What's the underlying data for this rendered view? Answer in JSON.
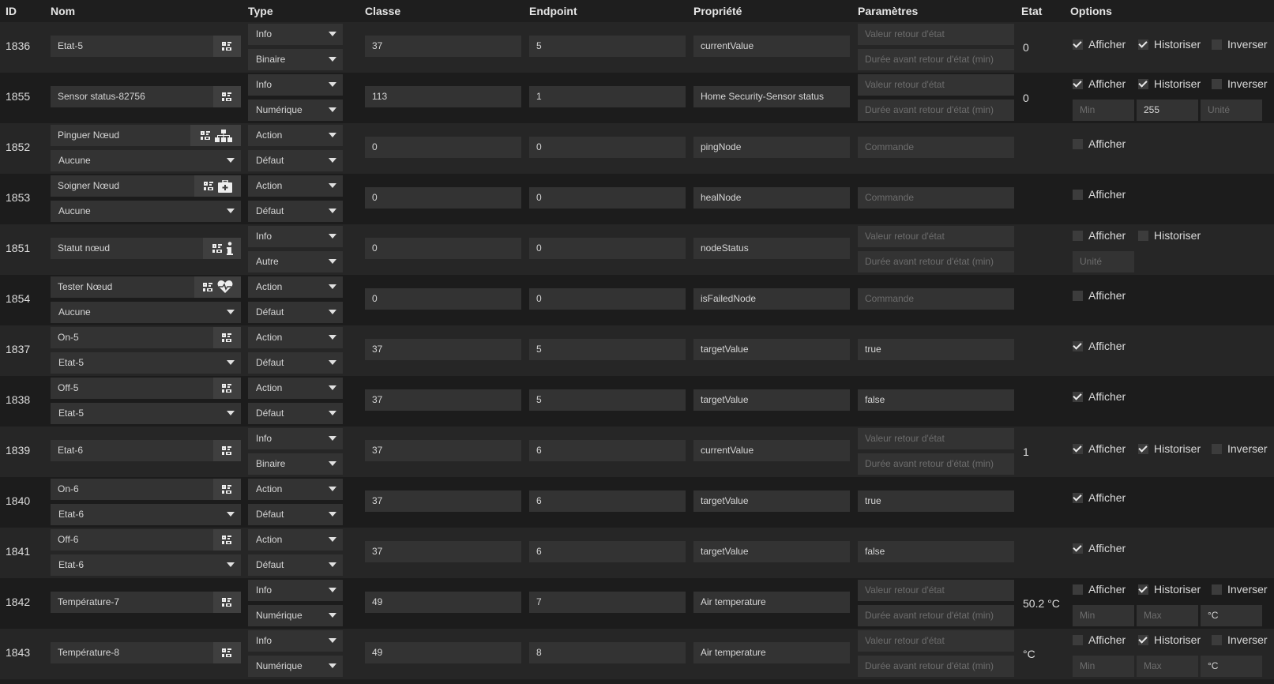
{
  "headers": {
    "id": "ID",
    "nom": "Nom",
    "type": "Type",
    "classe": "Classe",
    "endpoint": "Endpoint",
    "propriete": "Propriété",
    "parametres": "Paramètres",
    "etat": "Etat",
    "options": "Options"
  },
  "labels": {
    "afficher": "Afficher",
    "historiser": "Historiser",
    "inverser": "Inverser"
  },
  "placeholders": {
    "valeur_retour": "Valeur retour d'état",
    "duree_retour": "Durée avant retour d'état (min)",
    "commande": "Commande",
    "min": "Min",
    "max": "Max",
    "unite": "Unité"
  },
  "rows": [
    {
      "id": "1836",
      "name": "Etat-5",
      "type": "Info",
      "subtype": "Binaire",
      "classe": "37",
      "endpoint": "5",
      "propriete": "currentValue",
      "etat": "0",
      "afficher": true,
      "historiser": true,
      "inverser": false
    },
    {
      "id": "1855",
      "name": "Sensor status-82756",
      "type": "Info",
      "subtype": "Numérique",
      "classe": "113",
      "endpoint": "1",
      "propriete": "Home Security-Sensor status",
      "etat": "0",
      "afficher": true,
      "historiser": true,
      "inverser": false,
      "max": "255"
    },
    {
      "id": "1852",
      "name": "Pinguer Nœud",
      "action": "Aucune",
      "type": "Action",
      "subtype": "Défaut",
      "classe": "0",
      "endpoint": "0",
      "propriete": "pingNode",
      "afficher": false
    },
    {
      "id": "1853",
      "name": "Soigner Nœud",
      "action": "Aucune",
      "type": "Action",
      "subtype": "Défaut",
      "classe": "0",
      "endpoint": "0",
      "propriete": "healNode",
      "afficher": false
    },
    {
      "id": "1851",
      "name": "Statut nœud",
      "type": "Info",
      "subtype": "Autre",
      "classe": "0",
      "endpoint": "0",
      "propriete": "nodeStatus",
      "afficher": false,
      "historiser": false
    },
    {
      "id": "1854",
      "name": "Tester Nœud",
      "action": "Aucune",
      "type": "Action",
      "subtype": "Défaut",
      "classe": "0",
      "endpoint": "0",
      "propriete": "isFailedNode",
      "afficher": false
    },
    {
      "id": "1837",
      "name": "On-5",
      "action": "Etat-5",
      "type": "Action",
      "subtype": "Défaut",
      "classe": "37",
      "endpoint": "5",
      "propriete": "targetValue",
      "param": "true",
      "afficher": true
    },
    {
      "id": "1838",
      "name": "Off-5",
      "action": "Etat-5",
      "type": "Action",
      "subtype": "Défaut",
      "classe": "37",
      "endpoint": "5",
      "propriete": "targetValue",
      "param": "false",
      "afficher": true
    },
    {
      "id": "1839",
      "name": "Etat-6",
      "type": "Info",
      "subtype": "Binaire",
      "classe": "37",
      "endpoint": "6",
      "propriete": "currentValue",
      "etat": "1",
      "afficher": true,
      "historiser": true,
      "inverser": false
    },
    {
      "id": "1840",
      "name": "On-6",
      "action": "Etat-6",
      "type": "Action",
      "subtype": "Défaut",
      "classe": "37",
      "endpoint": "6",
      "propriete": "targetValue",
      "param": "true",
      "afficher": true
    },
    {
      "id": "1841",
      "name": "Off-6",
      "action": "Etat-6",
      "type": "Action",
      "subtype": "Défaut",
      "classe": "37",
      "endpoint": "6",
      "propriete": "targetValue",
      "param": "false",
      "afficher": true
    },
    {
      "id": "1842",
      "name": "Température-7",
      "type": "Info",
      "subtype": "Numérique",
      "classe": "49",
      "endpoint": "7",
      "propriete": "Air temperature",
      "etat": "50.2 °C",
      "afficher": false,
      "historiser": true,
      "inverser": false,
      "unit": "°C"
    },
    {
      "id": "1843",
      "name": "Température-8",
      "type": "Info",
      "subtype": "Numérique",
      "classe": "49",
      "endpoint": "8",
      "propriete": "Air temperature",
      "etat": "°C",
      "afficher": false,
      "historiser": true,
      "inverser": false,
      "unit": "°C"
    }
  ]
}
